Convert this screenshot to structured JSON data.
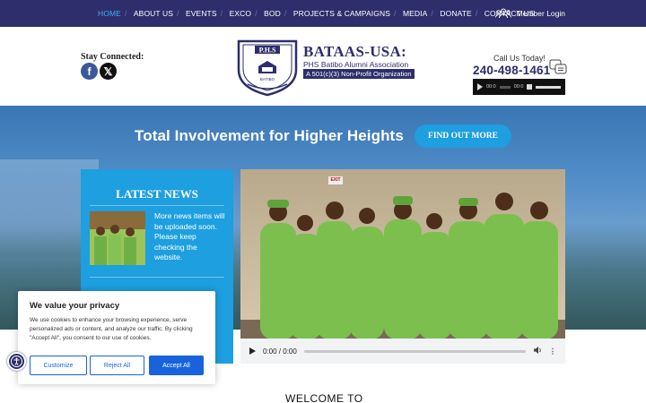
{
  "nav": {
    "items": [
      {
        "label": "HOME",
        "active": true
      },
      {
        "label": "ABOUT US"
      },
      {
        "label": "EVENTS"
      },
      {
        "label": "EXCO"
      },
      {
        "label": "BOD"
      },
      {
        "label": "PROJECTS & CAMPAIGNS"
      },
      {
        "label": "MEDIA"
      },
      {
        "label": "DONATE"
      },
      {
        "label": "CONTACT US"
      }
    ],
    "member_login": "Member Login",
    "member_icon": "users-icon"
  },
  "header": {
    "stay_connected": "Stay Connected:",
    "social": [
      {
        "icon": "facebook-icon",
        "glyph": "f"
      },
      {
        "icon": "x-twitter-icon",
        "glyph": "𝕏"
      }
    ],
    "logo_text": "P.H.S",
    "logo_sub": "BATIBO",
    "brand_title": "BATAAS-USA:",
    "brand_subtitle": "PHS Batibo Alumni Association",
    "brand_501": "A 501(c)(3) Non-Profit Organization",
    "call_us": "Call Us Today!",
    "phone": "240-498-1461",
    "audio_time_1": "00:0",
    "audio_time_2": "00:0"
  },
  "hero": {
    "title": "Total Involvement for Higher Heights",
    "button": "FIND OUT MORE"
  },
  "news": {
    "heading": "LATEST NEWS",
    "item_text": "More news items will be uploaded soon. Please keep checking the website."
  },
  "video": {
    "exit_sign": "EXIT",
    "time": "0:00 / 0:00"
  },
  "welcome": "WELCOME TO",
  "cookie": {
    "title": "We value your privacy",
    "body": "We use cookies to enhance your browsing experience, serve personalized ads or content, and analyze our traffic. By clicking \"Accept All\", you consent to our use of cookies.",
    "customize": "Customize",
    "reject": "Reject All",
    "accept": "Accept All"
  },
  "colors": {
    "navy": "#2d2e6b",
    "accent": "#1d9fe0",
    "active_nav": "#37b5f0",
    "cookie_blue": "#1863dc"
  }
}
